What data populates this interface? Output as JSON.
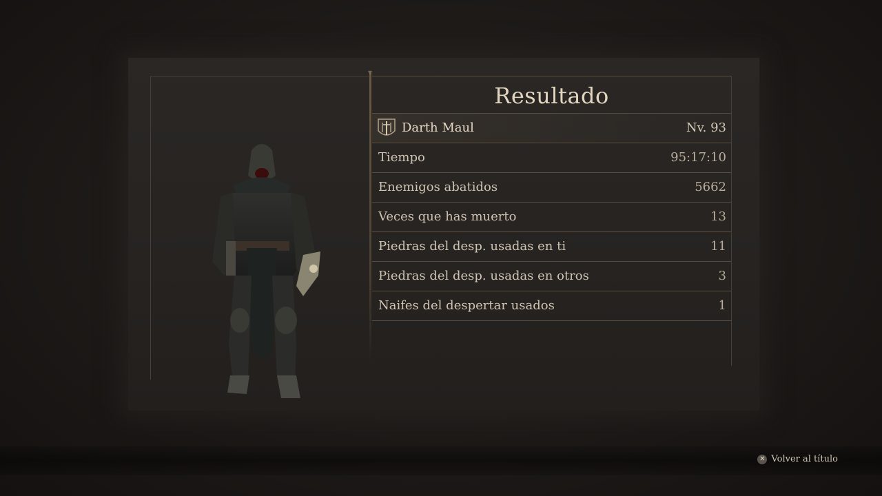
{
  "results": {
    "title": "Resultado",
    "character": {
      "name": "Darth Maul",
      "level": "Nv. 93"
    },
    "stats": [
      {
        "label": "Tiempo",
        "value": "95:17:10"
      },
      {
        "label": "Enemigos abatidos",
        "value": "5662"
      },
      {
        "label": "Veces que has muerto",
        "value": "13"
      },
      {
        "label": "Piedras del desp. usadas en ti",
        "value": "11"
      },
      {
        "label": "Piedras del desp. usadas en otros",
        "value": "3"
      },
      {
        "label": "Naifes del despertar usados",
        "value": "1"
      }
    ]
  },
  "footer": {
    "button_glyph": "✕",
    "back_label": "Volver al título"
  },
  "colors": {
    "text_primary": "#e2d6c0",
    "divider": "#5a4c3e",
    "background": "#1b1816"
  }
}
